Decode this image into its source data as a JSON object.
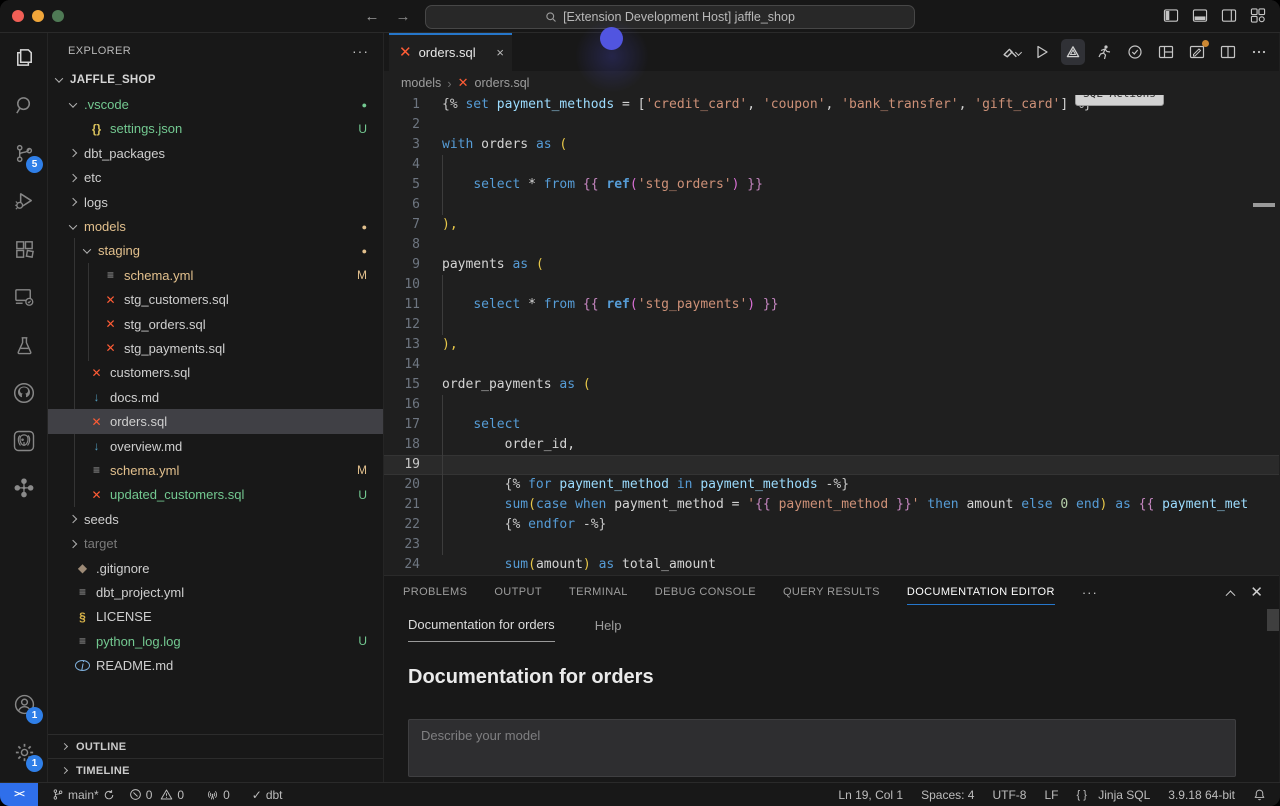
{
  "colors": {
    "accent": "#2677cb",
    "dbt_orange": "#ff5c35",
    "git_untracked": "#73c991",
    "git_modified": "#e2c08d",
    "remote_blue": "#2f6feb",
    "badge_blue": "#2f7fe8"
  },
  "titlebar": {
    "title": "[Extension Development Host] jaffle_shop"
  },
  "activity_bar": {
    "scm_badge": "5",
    "account_badge": "1",
    "settings_badge": "1"
  },
  "sidebar": {
    "header": "EXPLORER",
    "tree": [
      {
        "label": "JAFFLE_SHOP",
        "level": 0,
        "kind": "root",
        "expanded": true
      },
      {
        "label": ".vscode",
        "level": 1,
        "kind": "folder",
        "expanded": true,
        "color": "green",
        "right": "dot-green"
      },
      {
        "label": "settings.json",
        "level": 2,
        "kind": "file",
        "icon": "json-icon",
        "color": "green",
        "right": "U"
      },
      {
        "label": "dbt_packages",
        "level": 1,
        "kind": "folder",
        "expanded": false
      },
      {
        "label": "etc",
        "level": 1,
        "kind": "folder",
        "expanded": false
      },
      {
        "label": "logs",
        "level": 1,
        "kind": "folder",
        "expanded": false
      },
      {
        "label": "models",
        "level": 1,
        "kind": "folder",
        "expanded": true,
        "color": "mod",
        "right": "dot-mod"
      },
      {
        "label": "staging",
        "level": 2,
        "kind": "folder",
        "expanded": true,
        "color": "mod",
        "right": "dot-mod"
      },
      {
        "label": "schema.yml",
        "level": 3,
        "kind": "file",
        "icon": "yaml-icon",
        "color": "mod",
        "right": "M"
      },
      {
        "label": "stg_customers.sql",
        "level": 3,
        "kind": "file",
        "icon": "dbt-file-icon"
      },
      {
        "label": "stg_orders.sql",
        "level": 3,
        "kind": "file",
        "icon": "dbt-file-icon"
      },
      {
        "label": "stg_payments.sql",
        "level": 3,
        "kind": "file",
        "icon": "dbt-file-icon"
      },
      {
        "label": "customers.sql",
        "level": 2,
        "kind": "file",
        "icon": "dbt-file-icon"
      },
      {
        "label": "docs.md",
        "level": 2,
        "kind": "file",
        "icon": "markdown-icon"
      },
      {
        "label": "orders.sql",
        "level": 2,
        "kind": "file",
        "icon": "dbt-file-icon",
        "selected": true
      },
      {
        "label": "overview.md",
        "level": 2,
        "kind": "file",
        "icon": "markdown-icon"
      },
      {
        "label": "schema.yml",
        "level": 2,
        "kind": "file",
        "icon": "yaml-icon",
        "color": "mod",
        "right": "M"
      },
      {
        "label": "updated_customers.sql",
        "level": 2,
        "kind": "file",
        "icon": "dbt-file-icon",
        "color": "green",
        "right": "U"
      },
      {
        "label": "seeds",
        "level": 1,
        "kind": "folder",
        "expanded": false
      },
      {
        "label": "target",
        "level": 1,
        "kind": "folder",
        "expanded": false,
        "color": "dim"
      },
      {
        "label": ".gitignore",
        "level": 1,
        "kind": "file",
        "icon": "git-icon"
      },
      {
        "label": "dbt_project.yml",
        "level": 1,
        "kind": "file",
        "icon": "yaml-icon"
      },
      {
        "label": "LICENSE",
        "level": 1,
        "kind": "file",
        "icon": "license-icon"
      },
      {
        "label": "python_log.log",
        "level": 1,
        "kind": "file",
        "icon": "log-icon",
        "color": "green",
        "right": "U"
      },
      {
        "label": "README.md",
        "level": 1,
        "kind": "file",
        "icon": "info-icon"
      }
    ],
    "outline": "OUTLINE",
    "timeline": "TIMELINE"
  },
  "editor": {
    "tab": {
      "label": "orders.sql",
      "close": "×"
    },
    "tooltip": "SQL Actions",
    "breadcrumb": {
      "folder": "models",
      "file": "orders.sql"
    },
    "code": {
      "lines": [
        {
          "n": "1",
          "t": [
            [
              "{% ",
              "j"
            ],
            [
              "set",
              "k"
            ],
            [
              " ",
              "p"
            ],
            [
              "payment_methods",
              "v"
            ],
            [
              " = [",
              "p"
            ],
            [
              "'credit_card'",
              "s"
            ],
            [
              ", ",
              "p"
            ],
            [
              "'coupon'",
              "s"
            ],
            [
              ", ",
              "p"
            ],
            [
              "'bank_transfer'",
              "s"
            ],
            [
              ", ",
              "p"
            ],
            [
              "'gift_card'",
              "s"
            ],
            [
              "]",
              "p"
            ],
            [
              " %}",
              "j"
            ]
          ]
        },
        {
          "n": "2",
          "t": []
        },
        {
          "n": "3",
          "t": [
            [
              "with",
              "k"
            ],
            [
              " orders ",
              "p"
            ],
            [
              "as",
              "k"
            ],
            [
              " ",
              "p"
            ],
            [
              "(",
              "g"
            ]
          ]
        },
        {
          "n": "4",
          "t": []
        },
        {
          "n": "5",
          "t": [
            [
              "    ",
              "p"
            ],
            [
              "select",
              "k"
            ],
            [
              " * ",
              "p"
            ],
            [
              "from",
              "k"
            ],
            [
              " ",
              "p"
            ],
            [
              "{{ ",
              "b"
            ],
            [
              "ref",
              "f"
            ],
            [
              "(",
              "o"
            ],
            [
              "'stg_orders'",
              "s"
            ],
            [
              ")",
              "o"
            ],
            [
              " }}",
              "b"
            ]
          ]
        },
        {
          "n": "6",
          "t": []
        },
        {
          "n": "7",
          "t": [
            [
              "),",
              "g"
            ]
          ]
        },
        {
          "n": "8",
          "t": []
        },
        {
          "n": "9",
          "t": [
            [
              "payments ",
              "p"
            ],
            [
              "as",
              "k"
            ],
            [
              " ",
              "p"
            ],
            [
              "(",
              "g"
            ]
          ]
        },
        {
          "n": "10",
          "t": []
        },
        {
          "n": "11",
          "t": [
            [
              "    ",
              "p"
            ],
            [
              "select",
              "k"
            ],
            [
              " * ",
              "p"
            ],
            [
              "from",
              "k"
            ],
            [
              " ",
              "p"
            ],
            [
              "{{ ",
              "b"
            ],
            [
              "ref",
              "f"
            ],
            [
              "(",
              "o"
            ],
            [
              "'stg_payments'",
              "s"
            ],
            [
              ")",
              "o"
            ],
            [
              " }}",
              "b"
            ]
          ]
        },
        {
          "n": "12",
          "t": []
        },
        {
          "n": "13",
          "t": [
            [
              "),",
              "g"
            ]
          ]
        },
        {
          "n": "14",
          "t": []
        },
        {
          "n": "15",
          "t": [
            [
              "order_payments ",
              "p"
            ],
            [
              "as",
              "k"
            ],
            [
              " ",
              "p"
            ],
            [
              "(",
              "g"
            ]
          ]
        },
        {
          "n": "16",
          "t": []
        },
        {
          "n": "17",
          "t": [
            [
              "    ",
              "p"
            ],
            [
              "select",
              "k"
            ]
          ]
        },
        {
          "n": "18",
          "t": [
            [
              "        order_id,",
              "p"
            ]
          ]
        },
        {
          "n": "19",
          "t": [],
          "current": true
        },
        {
          "n": "20",
          "t": [
            [
              "        ",
              "p"
            ],
            [
              "{% ",
              "j"
            ],
            [
              "for",
              "k"
            ],
            [
              " ",
              "p"
            ],
            [
              "payment_method",
              "v"
            ],
            [
              " ",
              "p"
            ],
            [
              "in",
              "k"
            ],
            [
              " ",
              "p"
            ],
            [
              "payment_methods",
              "v"
            ],
            [
              " ",
              "p"
            ],
            [
              "-%}",
              "j"
            ]
          ]
        },
        {
          "n": "21",
          "t": [
            [
              "        ",
              "p"
            ],
            [
              "sum",
              "k"
            ],
            [
              "(",
              "g"
            ],
            [
              "case",
              "k"
            ],
            [
              " ",
              "p"
            ],
            [
              "when",
              "k"
            ],
            [
              " payment_method = ",
              "p"
            ],
            [
              "'",
              "s"
            ],
            [
              "{{",
              "b"
            ],
            [
              " payment_method ",
              "s"
            ],
            [
              "}}",
              "b"
            ],
            [
              "'",
              "s"
            ],
            [
              " ",
              "p"
            ],
            [
              "then",
              "k"
            ],
            [
              " amount ",
              "p"
            ],
            [
              "else",
              "k"
            ],
            [
              " ",
              "p"
            ],
            [
              "0",
              "n"
            ],
            [
              " ",
              "p"
            ],
            [
              "end",
              "k"
            ],
            [
              ")",
              "g"
            ],
            [
              " ",
              "p"
            ],
            [
              "as",
              "k"
            ],
            [
              " ",
              "p"
            ],
            [
              "{{",
              "b"
            ],
            [
              " ",
              "p"
            ],
            [
              "payment_met",
              "v"
            ]
          ]
        },
        {
          "n": "22",
          "t": [
            [
              "        ",
              "p"
            ],
            [
              "{% ",
              "j"
            ],
            [
              "endfor",
              "k"
            ],
            [
              " ",
              "p"
            ],
            [
              "-%}",
              "j"
            ]
          ]
        },
        {
          "n": "23",
          "t": []
        },
        {
          "n": "24",
          "t": [
            [
              "        ",
              "p"
            ],
            [
              "sum",
              "k"
            ],
            [
              "(",
              "g"
            ],
            [
              "amount",
              "p"
            ],
            [
              ")",
              "g"
            ],
            [
              " ",
              "p"
            ],
            [
              "as",
              "k"
            ],
            [
              " total_amount",
              "p"
            ]
          ]
        }
      ]
    }
  },
  "panel": {
    "tabs": [
      {
        "label": "PROBLEMS",
        "active": false
      },
      {
        "label": "OUTPUT",
        "active": false
      },
      {
        "label": "TERMINAL",
        "active": false
      },
      {
        "label": "DEBUG CONSOLE",
        "active": false
      },
      {
        "label": "QUERY RESULTS",
        "active": false
      },
      {
        "label": "DOCUMENTATION EDITOR",
        "active": true
      }
    ],
    "doc_tabs": [
      {
        "label": "Documentation for orders",
        "active": true
      },
      {
        "label": "Help",
        "active": false
      }
    ],
    "heading": "Documentation for orders",
    "description_placeholder": "Describe your model"
  },
  "status_bar": {
    "branch": "main*",
    "errors": "0",
    "warnings": "0",
    "ports": "0",
    "dbt": "dbt",
    "dbt_check": "✓",
    "line_col": "Ln 19, Col 1",
    "indent": "Spaces: 4",
    "encoding": "UTF-8",
    "eol": "LF",
    "language": "Jinja SQL",
    "python_version": "3.9.18 64-bit"
  }
}
